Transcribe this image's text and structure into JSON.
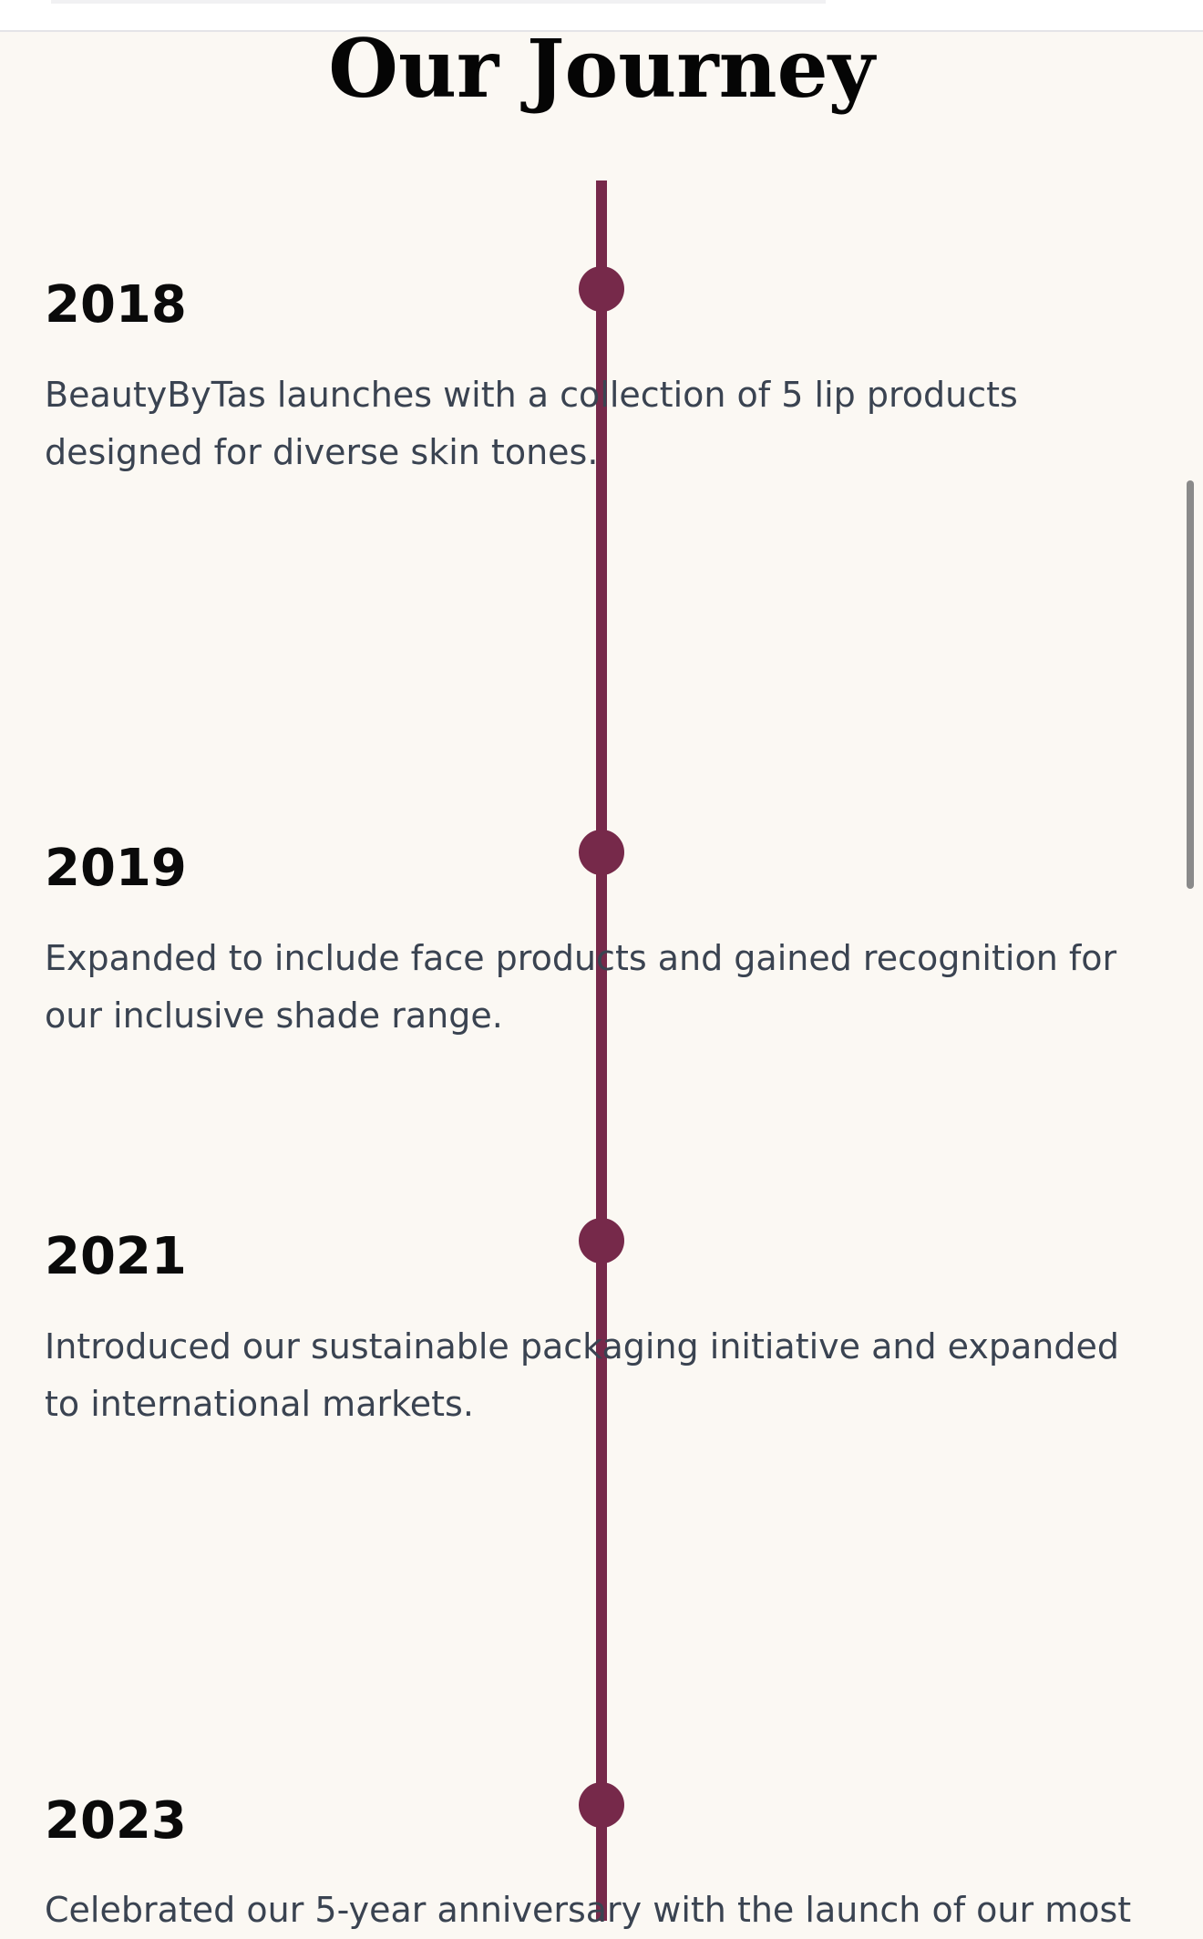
{
  "section": {
    "title": "Our Journey"
  },
  "timeline": {
    "entries": [
      {
        "year": "2018",
        "text": "BeautyByTas launches with a collection of 5 lip products designed for diverse skin tones."
      },
      {
        "year": "2019",
        "text": "Expanded to include face products and gained recognition for our inclusive shade range."
      },
      {
        "year": "2021",
        "text": "Introduced our sustainable packaging initiative and expanded to international markets."
      },
      {
        "year": "2023",
        "text": "Celebrated our 5-year anniversary with the launch of our most"
      }
    ]
  },
  "colors": {
    "accent": "#76294a",
    "background": "#fbf8f3",
    "heading": "#0a0a0a",
    "body_text": "#3a4351"
  }
}
